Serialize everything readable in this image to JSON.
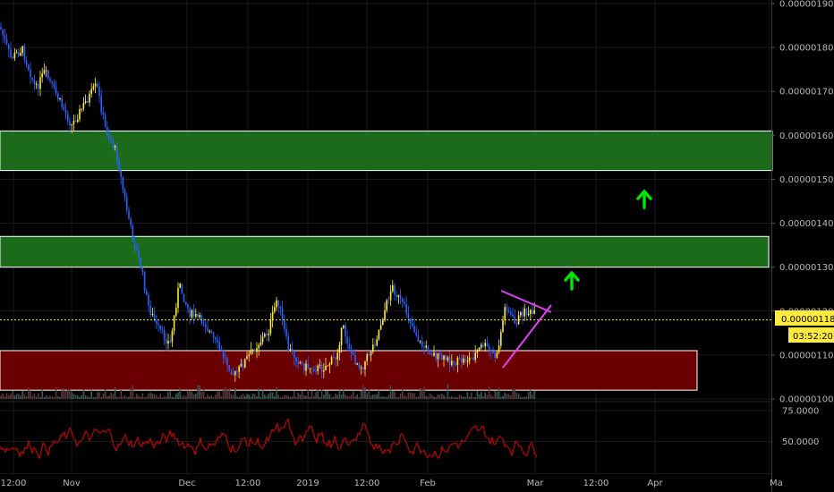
{
  "chart_data": {
    "type": "candlestick",
    "price_axis": {
      "ticks": [
        "0.00000190",
        "0.00000180",
        "0.00000170",
        "0.00000160",
        "0.00000150",
        "0.00000140",
        "0.00000130",
        "0.00000120",
        "0.00000110",
        "0.00000100"
      ],
      "ylim": [
        1e-06,
        1.9e-06
      ]
    },
    "indicator_axis": {
      "ticks": [
        "75.0000",
        "50.0000"
      ],
      "ylim": [
        25,
        80
      ]
    },
    "time_axis": {
      "labels": [
        "12:00",
        "Nov",
        "Dec",
        "12:00",
        "2019",
        "12:00",
        "Feb",
        "Mar",
        "12:00",
        "Apr",
        "Ma"
      ]
    },
    "current_price": {
      "value": 1.18e-06,
      "label": "0.00000118",
      "countdown": "03:52:20",
      "color": "#ffeb3b"
    },
    "zones": [
      {
        "name": "resistance-zone-upper",
        "from": 1.52e-06,
        "to": 1.61e-06,
        "color": "#1b6b1b"
      },
      {
        "name": "resistance-zone-lower",
        "from": 1.3e-06,
        "to": 1.37e-06,
        "color": "#1b6b1b"
      },
      {
        "name": "support-zone",
        "from": 1.02e-06,
        "to": 1.11e-06,
        "color": "#6b0000"
      }
    ],
    "colors": {
      "bull_candle": "#ffeb3b",
      "bear_candle": "#2962ff",
      "triangle": "#e040fb",
      "indicator_line": "#e00000",
      "arrows": "#00e600",
      "grid": "#1a1a1a"
    }
  }
}
